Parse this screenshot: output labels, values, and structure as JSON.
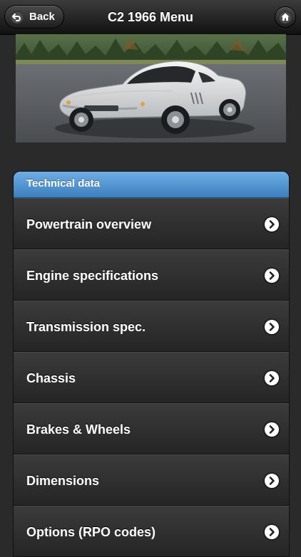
{
  "header": {
    "title": "C2 1966 Menu",
    "back_label": "Back"
  },
  "hero": {
    "description": ""
  },
  "list": {
    "section_title": "Technical data",
    "items": [
      {
        "label": "Powertrain overview"
      },
      {
        "label": "Engine specifications"
      },
      {
        "label": "Transmission spec."
      },
      {
        "label": "Chassis"
      },
      {
        "label": "Brakes & Wheels"
      },
      {
        "label": "Dimensions"
      },
      {
        "label": "Options (RPO codes)"
      }
    ]
  },
  "icons": {
    "back": "back-arrow-icon",
    "home": "home-icon",
    "chevron": "chevron-right-icon"
  },
  "colors": {
    "accent": "#4a8fd0",
    "header_bg": "#1c1c1c",
    "list_bg": "#2f2f2f"
  }
}
